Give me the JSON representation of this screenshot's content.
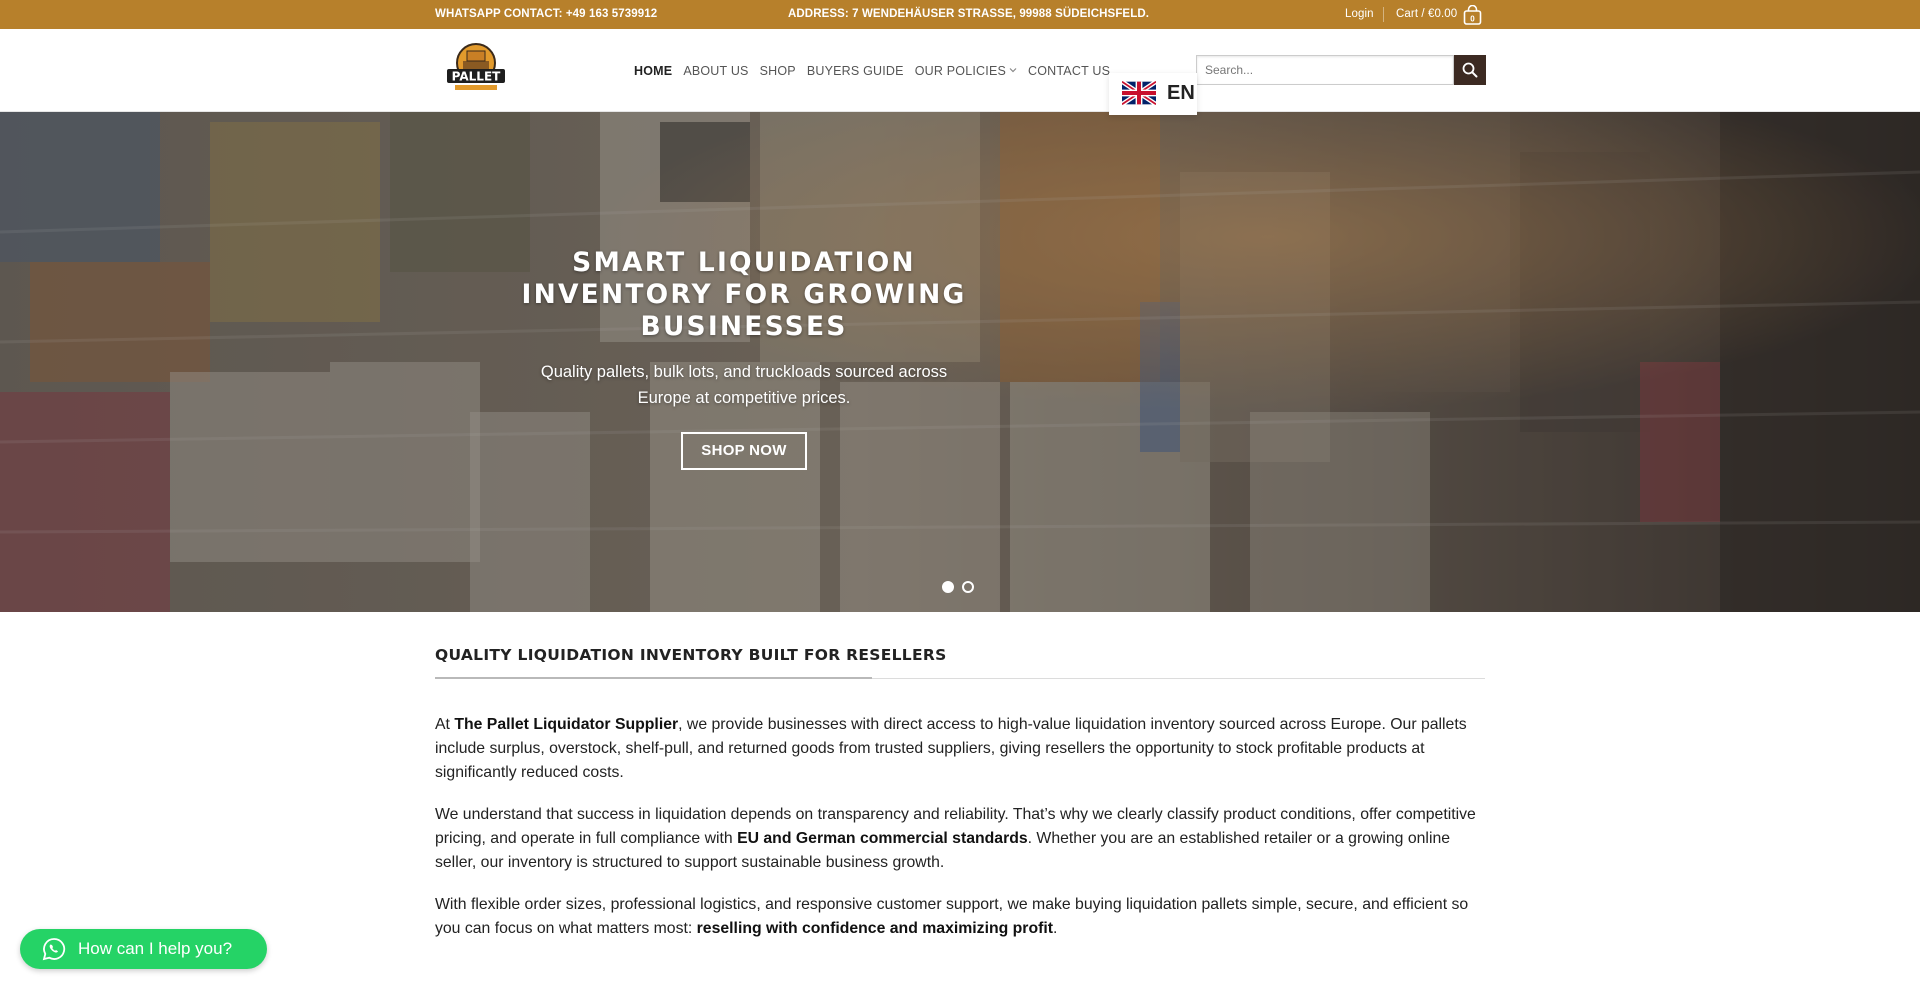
{
  "topbar": {
    "whatsapp": "WHATSAPP CONTACT: +49 163 5739912",
    "address": "ADDRESS: 7 WENDEHÄUSER STRASSE, 99988 SÜDEICHSFELD.",
    "login": "Login",
    "cart": "Cart / €0.00",
    "cart_count": "0"
  },
  "header": {
    "logo_text": "PALLET",
    "nav": [
      {
        "label": "HOME"
      },
      {
        "label": "ABOUT US"
      },
      {
        "label": "SHOP"
      },
      {
        "label": "BUYERS GUIDE"
      },
      {
        "label": "OUR POLICIES"
      },
      {
        "label": "CONTACT US"
      }
    ],
    "search_placeholder": "Search...",
    "language": "EN"
  },
  "hero": {
    "title": "SMART LIQUIDATION INVENTORY FOR GROWING BUSINESSES",
    "subtitle": "Quality pallets, bulk lots, and truckloads sourced across Europe at competitive prices.",
    "button": "SHOP NOW",
    "slides": 2,
    "active_slide": 1
  },
  "content": {
    "section_title": "QUALITY LIQUIDATION INVENTORY BUILT FOR RESELLERS",
    "p1": {
      "pre": "At ",
      "bold": "The Pallet Liquidator Supplier",
      "post": ", we provide businesses with direct access to high-value liquidation inventory sourced across Europe. Our pallets include surplus, overstock, shelf-pull, and returned goods from trusted suppliers, giving resellers the opportunity to stock profitable products at significantly reduced costs."
    },
    "p2": {
      "pre": "We understand that success in liquidation depends on transparency and reliability. That’s why we clearly classify product conditions, offer competitive pricing, and operate in full compliance with ",
      "bold": "EU and German commercial standards",
      "post": ". Whether you are an established retailer or a growing online seller, our inventory is structured to support sustainable business growth."
    },
    "p3": {
      "pre": "With flexible order sizes, professional logistics, and responsive customer support, we make buying liquidation pallets simple, secure, and efficient so you can focus on what matters most: ",
      "bold": "reselling with confidence and maximizing profit",
      "post": "."
    }
  },
  "whatsapp_widget": {
    "label": "How can I help you?"
  },
  "colors": {
    "topbar": "#b7802b",
    "search_button": "#3c2a22",
    "whatsapp": "#25d366"
  }
}
